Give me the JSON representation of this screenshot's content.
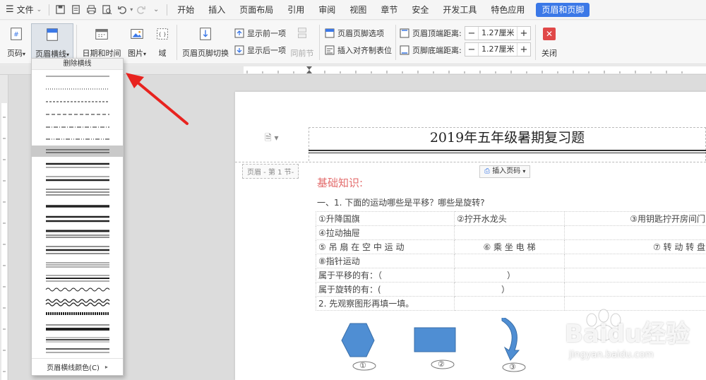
{
  "menubar": {
    "file_label": "文件",
    "tabs": [
      "开始",
      "插入",
      "页面布局",
      "引用",
      "审阅",
      "视图",
      "章节",
      "安全",
      "开发工具",
      "特色应用"
    ],
    "active_tab": "页眉和页脚"
  },
  "ribbon": {
    "page_number": "页码",
    "header_line": "页眉横线",
    "date_time": "日期和时间",
    "picture": "图片",
    "field": "域",
    "switch_header_footer": "页眉页脚切换",
    "show_previous": "显示前一项",
    "show_next": "显示后一项",
    "same_as_previous": "同前节",
    "header_footer_options": "页眉页脚选项",
    "insert_align_tab": "插入对齐制表位",
    "header_top_label": "页眉顶端距离:",
    "header_top_value": "1.27厘米",
    "footer_bottom_label": "页脚底端距离:",
    "footer_bottom_value": "1.27厘米",
    "close": "关闭"
  },
  "dropdown": {
    "delete_line": "删除横线",
    "line_color": "页眉横线颜色(C)",
    "line_styles": [
      "thin",
      "dotted",
      "dashed",
      "dash",
      "dash-dot",
      "dash-dot-dot",
      "double",
      "thick-thin",
      "thin-thick",
      "triple",
      "thick",
      "double-thick",
      "thick-double",
      "thin-thick-thin",
      "triple-thin",
      "thin-thick-thin-2",
      "wave",
      "double-wave",
      "dash-hatched",
      "thick-thin-2",
      "gradient",
      "double-2"
    ],
    "highlighted_index": 6
  },
  "document": {
    "header_title": "2019年五年级暑期复习题",
    "header_tag": "页眉 - 第 1 节-",
    "insert_page_number": "插入页码",
    "section_heading": "基础知识:",
    "question": "一、1. 下面的运动哪些是平移？哪些是旋转?",
    "table_rows": [
      [
        "①升降国旗",
        "②拧开水龙头",
        "③用钥匙拧开房间门"
      ],
      [
        "④拉动抽屉",
        "",
        ""
      ],
      [
        "⑤ 吊 扇 在 空 中 运 动",
        "⑥ 乘 坐 电 梯",
        "⑦ 转 动 转 盘"
      ],
      [
        "⑧指针运动",
        "",
        ""
      ],
      [
        "属于平移的有：（",
        "）",
        ""
      ],
      [
        "属于旋转的有：(",
        "）",
        ""
      ],
      [
        "2.  先观察图形再填一填。",
        "",
        ""
      ]
    ],
    "shape_labels": [
      "①",
      "②",
      "③"
    ]
  },
  "watermark": {
    "brand": "Baidu经验",
    "url": "jingyan.baidu.com"
  },
  "colors": {
    "accent": "#3b78e7",
    "heading": "#e36c6c",
    "shape_fill": "#4f8ed3",
    "arrow": "#e8231f",
    "close_button": "#e04848"
  }
}
